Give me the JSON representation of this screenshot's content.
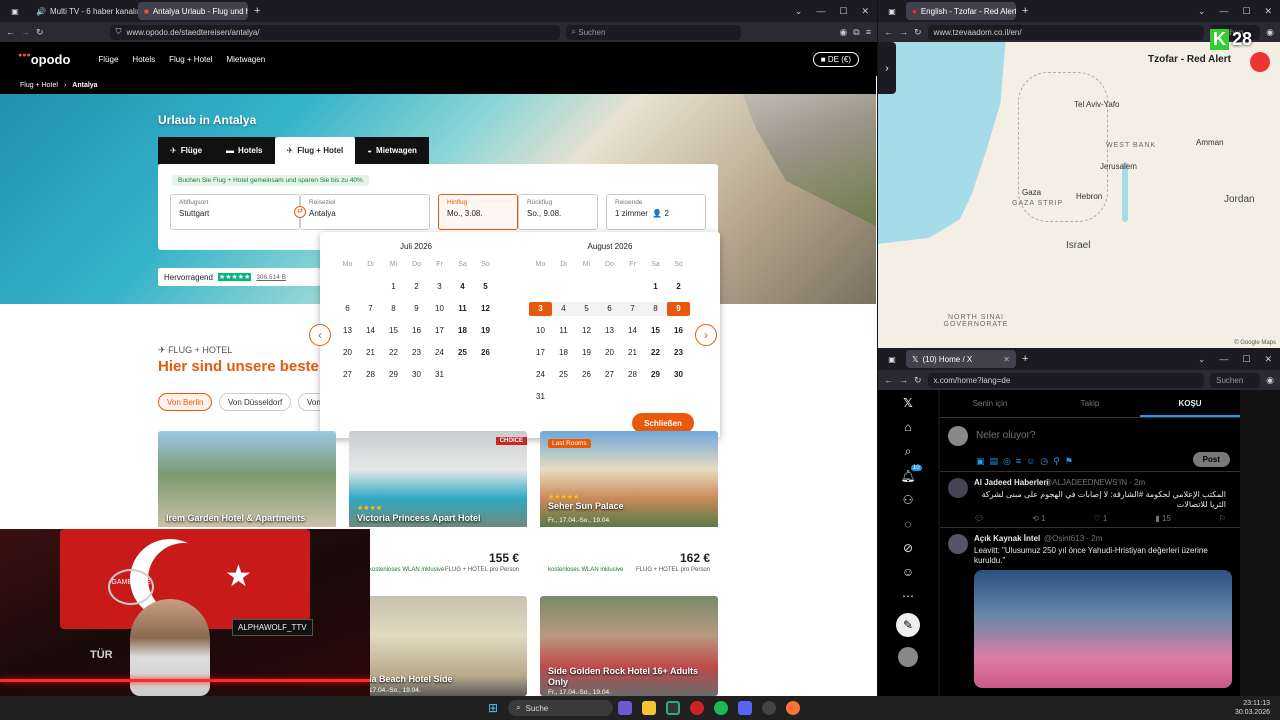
{
  "left_window": {
    "tabs": [
      {
        "label": "Multi TV - 6 haber kanalını"
      },
      {
        "label": "Antalya Urlaub - Flug und hotel"
      }
    ],
    "url": "www.opodo.de/staedtereisen/antalya/",
    "search_placeholder": "Suchen",
    "nav": {
      "logo": "opodo",
      "items": [
        "Flüge",
        "Hotels",
        "Flug + Hotel",
        "Mietwagen"
      ],
      "lang": "DE (€)"
    },
    "breadcrumb": [
      "Flug + Hotel",
      "Antalya"
    ],
    "hero_title": "Urlaub in Antalya",
    "search_tabs": [
      "Flüge",
      "Hotels",
      "Flug + Hotel",
      "Mietwagen"
    ],
    "promo": "Buchen Sie Flug + Hotel gemeinsam und sparen Sie bis zu 40%",
    "fields": {
      "origin": {
        "label": "Abflugsort",
        "value": "Stuttgart"
      },
      "destination": {
        "label": "Reiseziel",
        "value": "Antalya"
      },
      "depart": {
        "label": "Hinflug",
        "value": "Mo., 3.08."
      },
      "return": {
        "label": "Rückflug",
        "value": "So., 9.08."
      },
      "travellers": {
        "label": "Reisende",
        "value": "1 zimmer",
        "count": "2"
      }
    },
    "rating": {
      "label": "Hervorragend",
      "count": "306.514 B"
    },
    "calendar": {
      "weekdays": [
        "Mo",
        "Di",
        "Mi",
        "Do",
        "Fr",
        "Sa",
        "So"
      ],
      "months": [
        {
          "name": "Juli 2026",
          "offset": 2,
          "days": 31
        },
        {
          "name": "August 2026",
          "offset": 5,
          "days": 31
        }
      ],
      "close_label": "Schließen"
    },
    "section": {
      "kicker": "FLUG + HOTEL",
      "title": "Hier sind unsere beste"
    },
    "origin_pills": [
      "Von Berlin",
      "Von Düsseldorf",
      "Von"
    ],
    "cards": [
      {
        "title": "Irem Garden Hotel & Apartments",
        "badge": "",
        "price": "",
        "dates": ""
      },
      {
        "title": "Victoria Princess Apart Hotel",
        "badge": "CHOICE",
        "stars": "★★★★",
        "price": "155 €",
        "note": "kostenloses WLAN inklusive",
        "type": "FLUG + HOTEL",
        "per": "pro Person"
      },
      {
        "title": "Seher Sun Palace",
        "badge": "Last Rooms",
        "stars": "★★★★★",
        "dates": "Fr., 17.04.-So., 19.04.",
        "price": "162 €",
        "note": "kostenloses WLAN inklusive",
        "type": "FLUG + HOTEL",
        "per": "pro Person"
      },
      {
        "title": "ia Beach Hotel Side",
        "dates": "17.04.-So., 19.04."
      },
      {
        "title": "Side Golden Rock Hotel 16+ Adults Only",
        "dates": "Fr., 17.04.-So., 19.04."
      }
    ]
  },
  "map_window": {
    "tab": "English - Tzofar - Red Alert",
    "url": "www.tzevaadom.co.il/en/",
    "search_placeholder": "Suchen",
    "overlay_title": "Tzofar - Red Alert",
    "badge_k": "K",
    "badge_num": "28",
    "labels": [
      "Tel Aviv-Yafo",
      "Jerusalem",
      "Hebron",
      "WEST BANK",
      "Amman",
      "Jordan",
      "Gaza",
      "GAZA STRIP",
      "Israel",
      "NORTH SINAI GOVERNORATE"
    ],
    "attribution": "© Google Maps"
  },
  "x_window": {
    "tab": "(10) Home / X",
    "url": "x.com/home?lang=de",
    "search_placeholder": "Suchen",
    "feed_tabs": [
      "Senin için",
      "Takip",
      "KOŞU"
    ],
    "compose_placeholder": "Neler oluyor?",
    "post_label": "Post",
    "notif_count": "10",
    "posts": [
      {
        "name": "Al Jadeed Haberleri",
        "handle": "@ALJADEEDNEWS'IN · 2m",
        "text": "المكتب الإعلامي لحكومة #الشارقة: لا إصابات في الهجوم على مبنى لشركة الثريا للاتصالات",
        "replies": "",
        "reposts": "1",
        "likes": "1",
        "views": "15"
      },
      {
        "name": "Açık Kaynak İntel",
        "handle": "@Osint613 · 2m",
        "text": "Leavitt: \"Ulusumuz 250 yıl önce Yahudi-Hristiyan değerleri üzerine kuruldu.\""
      }
    ]
  },
  "webcam": {
    "banner": "ALPHAWOLF_TTV",
    "logo": "GAME TIME",
    "flag_text": "TÜR"
  },
  "taskbar": {
    "search": "Suche",
    "time": "23:11:13",
    "date": "30.03.2026"
  },
  "colors": {
    "accent": "#e8590c",
    "firefox_dark": "#1c1b22",
    "trustpilot": "#00b67a"
  }
}
